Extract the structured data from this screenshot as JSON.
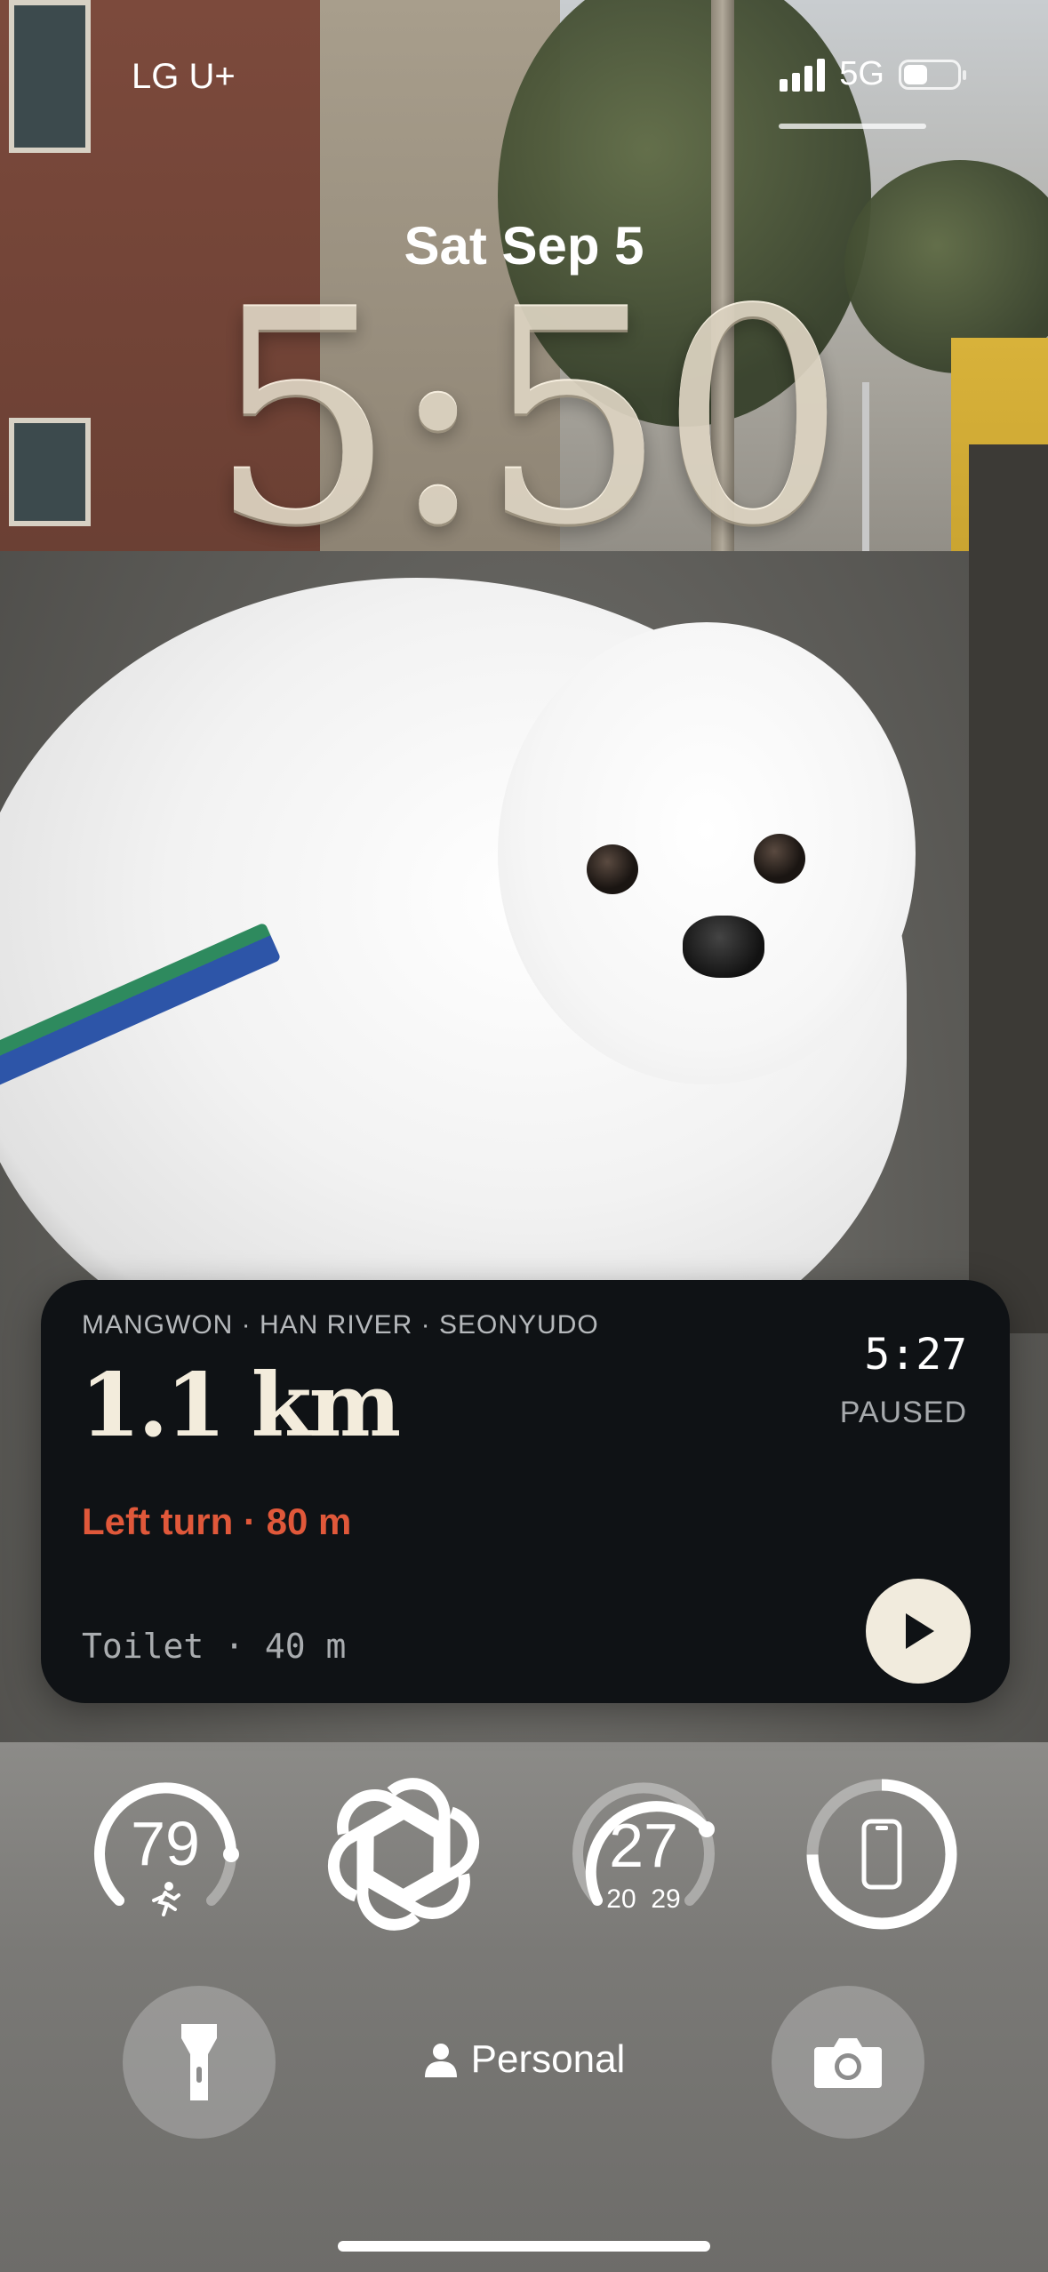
{
  "status_bar": {
    "carrier": "LG U+",
    "network": "5G",
    "signal_bars": 4,
    "battery_level": 0.4
  },
  "lock": {
    "date": "Sat Sep 5",
    "time": "5:50"
  },
  "live_activity": {
    "route": "MANGWON · HAN RIVER · SEONYUDO",
    "distance": "1.1 km",
    "elapsed": "5:27",
    "status": "PAUSED",
    "next_turn": "Left turn · 80 m",
    "poi": "Toilet · 40 m",
    "accent_color": "#e0583a"
  },
  "widgets": {
    "activity": {
      "value": "79",
      "icon": "running-person-icon",
      "level": 0.79
    },
    "app": {
      "icon": "chatgpt-logo-icon"
    },
    "weather": {
      "temp": "27",
      "low": "20",
      "high": "29",
      "level": 0.7
    },
    "battery": {
      "icon": "phone-icon",
      "level": 0.75
    }
  },
  "bottom": {
    "flashlight_icon": "flashlight-icon",
    "focus_label": "Personal",
    "focus_icon": "person-icon",
    "camera_icon": "camera-icon"
  }
}
